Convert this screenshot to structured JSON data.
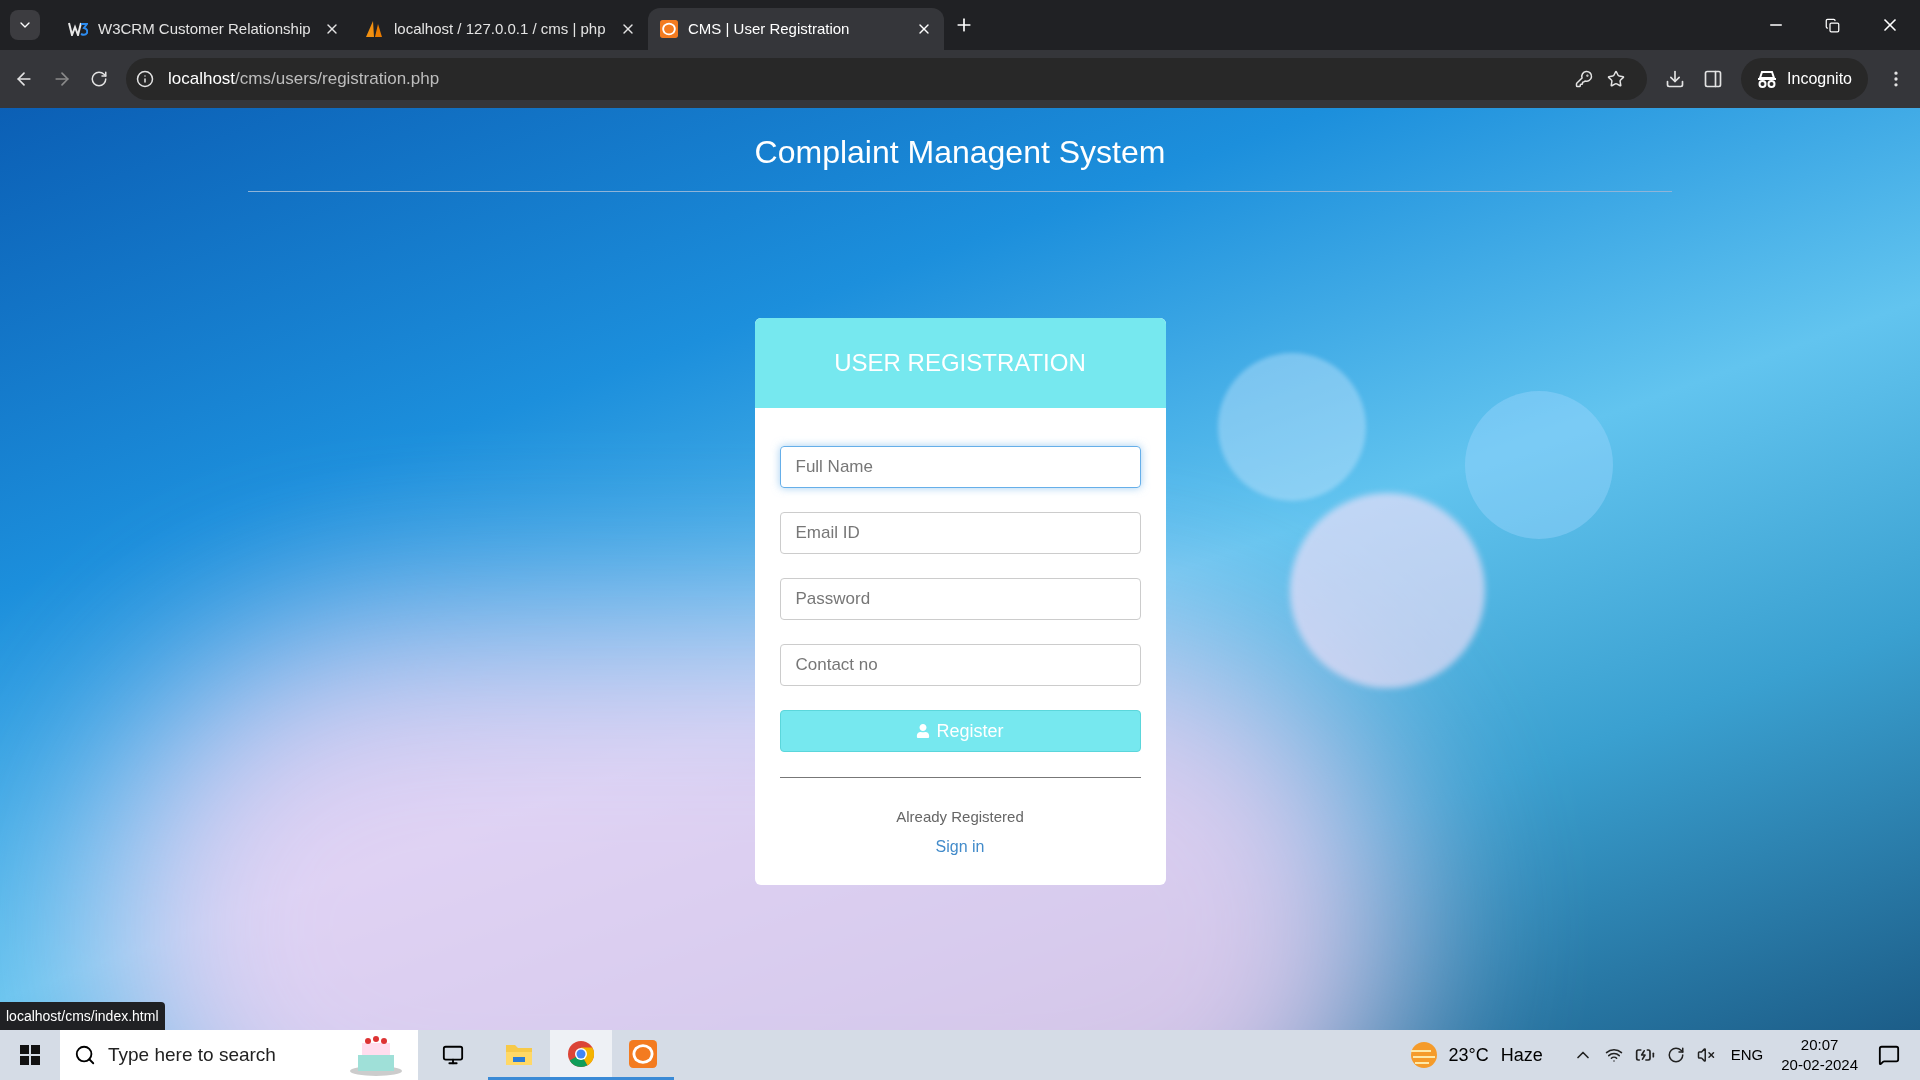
{
  "browser": {
    "tabs": [
      {
        "title": "W3CRM Customer Relationship",
        "kind": "w3crm",
        "selected": false
      },
      {
        "title": "localhost / 127.0.0.1 / cms | php",
        "kind": "phpmyadmin",
        "selected": false
      },
      {
        "title": "CMS | User Registration",
        "kind": "xampp",
        "selected": true
      }
    ],
    "address": {
      "host": "localhost",
      "path": "/cms/users/registration.php"
    },
    "incognito": "Incognito"
  },
  "page": {
    "title": "Complaint Managent System",
    "form": {
      "heading": "USER REGISTRATION",
      "fields": [
        {
          "placeholder": "Full Name",
          "focused": true
        },
        {
          "placeholder": "Email ID",
          "focused": false
        },
        {
          "placeholder": "Password",
          "focused": false
        },
        {
          "placeholder": "Contact no",
          "focused": false
        }
      ],
      "button": "Register",
      "note": "Already Registered",
      "link": "Sign in"
    }
  },
  "status_url": "localhost/cms/index.html",
  "taskbar": {
    "search": "Type here to search",
    "apps": [
      {
        "kind": "explorer",
        "selected": false
      },
      {
        "kind": "chrome",
        "selected": true
      },
      {
        "kind": "xampp",
        "selected": false
      }
    ],
    "weather": {
      "temp": "23°C",
      "condition": "Haze"
    },
    "language": "ENG",
    "time": "20:07",
    "date": "20-02-2024"
  }
}
